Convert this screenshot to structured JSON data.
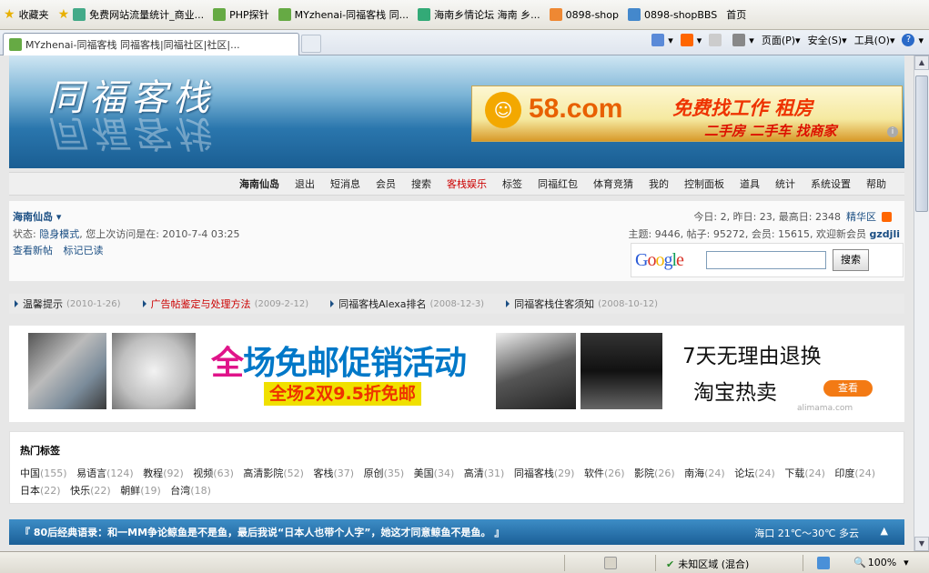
{
  "browser": {
    "favbar": {
      "favorites_label": "收藏夹",
      "items": [
        {
          "label": "免费网站流量统计_商业..."
        },
        {
          "label": "PHP探针"
        },
        {
          "label": "MYzhenai-同福客栈 同..."
        },
        {
          "label": "海南乡情论坛 海南 乡..."
        },
        {
          "label": "0898-shop"
        },
        {
          "label": "0898-shopBBS"
        },
        {
          "label": "首页"
        }
      ]
    },
    "active_tab": {
      "title": "MYzhenai-同福客栈 同福客栈|同福社区|社区|..."
    },
    "command_bar": {
      "page": "页面(P)",
      "safety": "安全(S)",
      "tools": "工具(O)",
      "help": "?"
    },
    "statusbar": {
      "zone": "未知区域 (混合)",
      "zoom": "100%"
    }
  },
  "site": {
    "logo": "同福客栈",
    "ad": {
      "brand": "58.com",
      "slogan1": "免费找工作 租房",
      "slogan2": "二手房 二手车 找商家"
    },
    "nav": [
      {
        "label": "海南仙岛"
      },
      {
        "label": "退出"
      },
      {
        "label": "短消息"
      },
      {
        "label": "会员"
      },
      {
        "label": "搜索"
      },
      {
        "label": "客栈娱乐"
      },
      {
        "label": "标签"
      },
      {
        "label": "同福红包"
      },
      {
        "label": "体育竞猜"
      },
      {
        "label": "我的"
      },
      {
        "label": "控制面板"
      },
      {
        "label": "道具"
      },
      {
        "label": "统计"
      },
      {
        "label": "系统设置"
      },
      {
        "label": "帮助"
      }
    ],
    "user": {
      "name": "海南仙岛",
      "status_prefix": "状态:",
      "status_mode": "隐身模式",
      "last_visit": ", 您上次访问是在: 2010-7-4 03:25",
      "link_new": "查看新帖",
      "link_read": "标记已读"
    },
    "stats": {
      "line1": "今日: 2, 昨日: 23, 最高日: 2348",
      "highlight_link": "精华区",
      "line2": "主题: 9446, 帖子: 95272, 会员: 15615, 欢迎新会员",
      "new_member": "gzdjli"
    },
    "search": {
      "logo": "Google",
      "button": "搜索"
    },
    "announcements": [
      {
        "title": "温馨提示",
        "date": "(2010-1-26)"
      },
      {
        "title": "广告帖鉴定与处理方法",
        "date": "(2009-2-12)"
      },
      {
        "title": "同福客栈Alexa排名",
        "date": "(2008-12-3)"
      },
      {
        "title": "同福客栈住客须知",
        "date": "(2008-10-12)"
      }
    ],
    "banner": {
      "headline_first": "全",
      "headline_rest": "场免邮促销活动",
      "sub": "全场2双9.5折免邮",
      "right1": "7天无理由退换",
      "right2": "淘宝热卖",
      "cta": "查看",
      "watermark": "alimama.com"
    },
    "hot_tags": {
      "title": "热门标签",
      "tags": [
        {
          "name": "中国",
          "count": "(155)"
        },
        {
          "name": "易语言",
          "count": "(124)"
        },
        {
          "name": "教程",
          "count": "(92)"
        },
        {
          "name": "视频",
          "count": "(63)"
        },
        {
          "name": "高清影院",
          "count": "(52)"
        },
        {
          "name": "客栈",
          "count": "(37)"
        },
        {
          "name": "原创",
          "count": "(35)"
        },
        {
          "name": "美国",
          "count": "(34)"
        },
        {
          "name": "高清",
          "count": "(31)"
        },
        {
          "name": "同福客栈",
          "count": "(29)"
        },
        {
          "name": "软件",
          "count": "(26)"
        },
        {
          "name": "影院",
          "count": "(26)"
        },
        {
          "name": "南海",
          "count": "(24)"
        },
        {
          "name": "论坛",
          "count": "(24)"
        },
        {
          "name": "下载",
          "count": "(24)"
        },
        {
          "name": "印度",
          "count": "(24)"
        },
        {
          "name": "日本",
          "count": "(22)"
        },
        {
          "name": "快乐",
          "count": "(22)"
        },
        {
          "name": "朝鲜",
          "count": "(19)"
        },
        {
          "name": "台湾",
          "count": "(18)"
        }
      ]
    },
    "quote": {
      "text": "『 80后经典语录：和一MM争论鲸鱼是不是鱼，最后我说“日本人也带个人字”，她这才同意鲸鱼不是鱼。 』",
      "weather": "海口 21℃～30℃ 多云",
      "toggle": "▲"
    }
  },
  "colors": {
    "brand_blue": "#1a5e93",
    "link": "#1a4e83",
    "highlight": "#cc0000"
  }
}
